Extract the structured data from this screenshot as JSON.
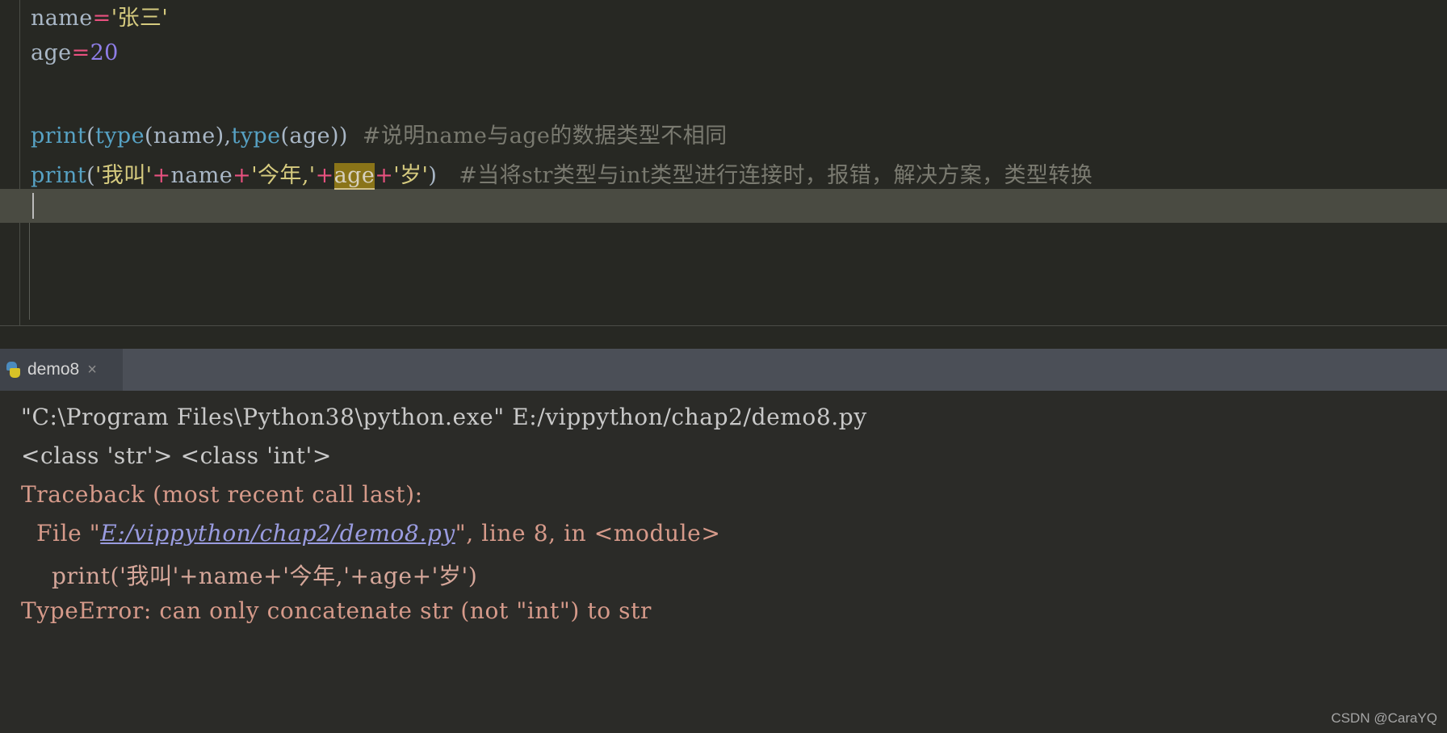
{
  "editor": {
    "lines": [
      {
        "id": "line-1",
        "tokens": [
          {
            "text": "name",
            "cls": "t-ident"
          },
          {
            "text": "=",
            "cls": "t-op"
          },
          {
            "text": "'张三'",
            "cls": "t-str"
          }
        ]
      },
      {
        "id": "line-2",
        "tokens": [
          {
            "text": "age",
            "cls": "t-ident"
          },
          {
            "text": "=",
            "cls": "t-op"
          },
          {
            "text": "20",
            "cls": "t-num"
          }
        ]
      },
      {
        "id": "line-4",
        "tokens": [
          {
            "text": "print",
            "cls": "t-func"
          },
          {
            "text": "(",
            "cls": "t-punct"
          },
          {
            "text": "type",
            "cls": "t-func"
          },
          {
            "text": "(name),",
            "cls": "t-punct"
          },
          {
            "text": "type",
            "cls": "t-func"
          },
          {
            "text": "(age))",
            "cls": "t-punct"
          },
          {
            "text": "  #说明name与age的数据类型不相同",
            "cls": "t-comment"
          }
        ]
      },
      {
        "id": "line-5",
        "tokens": [
          {
            "text": "print",
            "cls": "t-func"
          },
          {
            "text": "(",
            "cls": "t-punct"
          },
          {
            "text": "'我叫'",
            "cls": "t-str"
          },
          {
            "text": "+",
            "cls": "t-op"
          },
          {
            "text": "name",
            "cls": "t-ident"
          },
          {
            "text": "+",
            "cls": "t-op"
          },
          {
            "text": "'今年,'",
            "cls": "t-str"
          },
          {
            "text": "+",
            "cls": "t-op"
          },
          {
            "text": "age",
            "cls": "t-hl"
          },
          {
            "text": "+",
            "cls": "t-op"
          },
          {
            "text": "'岁'",
            "cls": "t-str"
          },
          {
            "text": ")",
            "cls": "t-punct"
          },
          {
            "text": "   #当将str类型与int类型进行连接时，报错，解决方案，类型转换",
            "cls": "t-comment"
          }
        ]
      }
    ]
  },
  "console": {
    "tab": {
      "label": "demo8",
      "close_label": "×",
      "icon": "python-file-icon"
    },
    "output_lines": [
      {
        "id": "out-0",
        "parts": [
          {
            "text": "\"C:\\Program Files\\Python38\\python.exe\" E:/vippython/chap2/demo8.py",
            "cls": ""
          }
        ]
      },
      {
        "id": "out-1",
        "parts": [
          {
            "text": "<class 'str'> <class 'int'>",
            "cls": ""
          }
        ]
      },
      {
        "id": "out-2",
        "parts": [
          {
            "text": "Traceback (most recent call last):",
            "cls": ""
          }
        ]
      },
      {
        "id": "out-3",
        "parts": [
          {
            "text": "  File \"",
            "cls": ""
          },
          {
            "text": "E:/vippython/chap2/demo8.py",
            "cls": "link"
          },
          {
            "text": "\", line 8, in <module>",
            "cls": ""
          }
        ]
      },
      {
        "id": "out-4",
        "parts": [
          {
            "text": "    print('我叫'+name+'今年,'+age+'岁')",
            "cls": ""
          }
        ]
      },
      {
        "id": "out-5",
        "parts": [
          {
            "text": "TypeError: can only concatenate str (not \"int\") to str",
            "cls": ""
          }
        ]
      }
    ]
  },
  "watermark": {
    "text": "CSDN @CaraYQ"
  },
  "colors": {
    "editor_bg": "#272823",
    "console_bg": "#2b2b28",
    "tab_strip_bg": "#4b4f57",
    "current_line": "#4a4b42",
    "error_text": "#d69a8a",
    "link": "#9a9ce0",
    "string": "#d6cb7f",
    "function": "#57a2c4",
    "operator": "#e8517f",
    "number": "#8f7ee8",
    "comment": "#7a7a70",
    "highlight": "#8a7418"
  }
}
